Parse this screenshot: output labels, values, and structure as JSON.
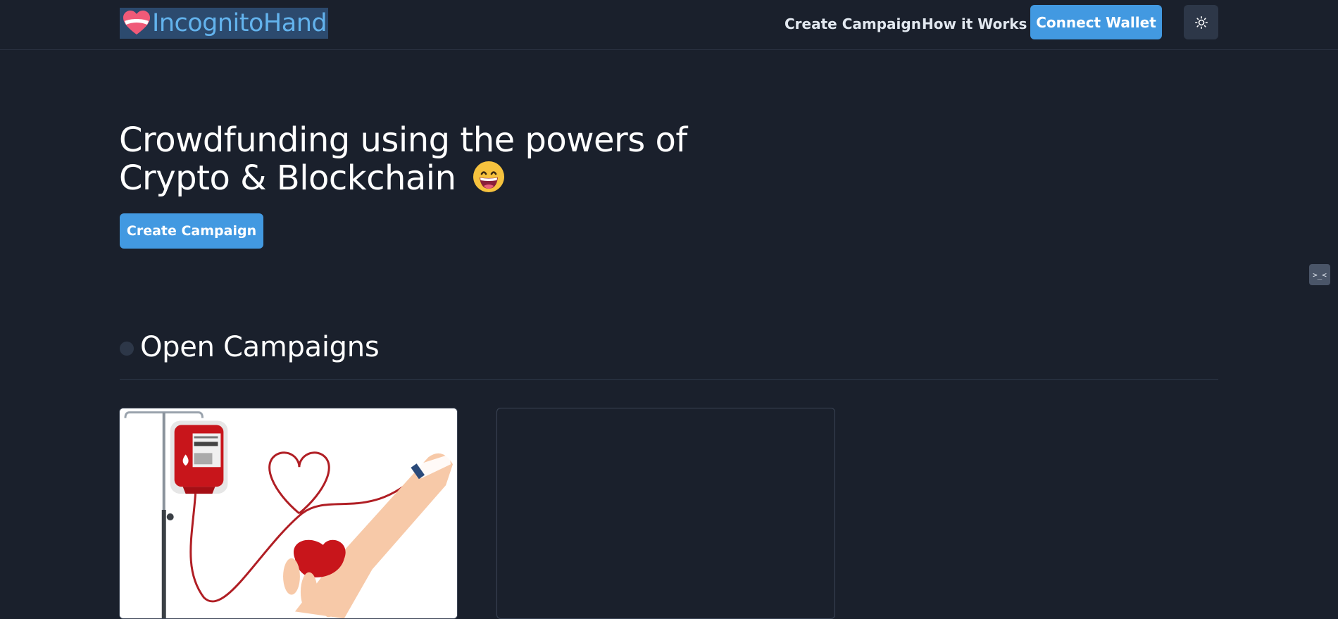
{
  "navbar": {
    "logo_text": "IncognitoHand",
    "links": {
      "create_campaign": "Create Campaign",
      "how_it_works": "How it Works"
    },
    "connect_wallet_label": "Connect Wallet",
    "theme_toggle_icon": "sun-icon"
  },
  "hero": {
    "title_line1": "Crowdfunding using the powers of",
    "title_line2": "Crypto & Blockchain",
    "emoji": "grinning-face-emoji",
    "cta_label": "Create Campaign"
  },
  "side_widget": {
    "label": ">_<"
  },
  "campaigns": {
    "section_title": "Open Campaigns",
    "cards": [
      {
        "image": "blood-donation-illustration"
      },
      {
        "image": "empty-placeholder"
      }
    ]
  },
  "colors": {
    "background": "#1a202c",
    "accent": "#4299e1",
    "logo_text": "#63b3ed",
    "logo_highlight": "#2c4a6e"
  }
}
